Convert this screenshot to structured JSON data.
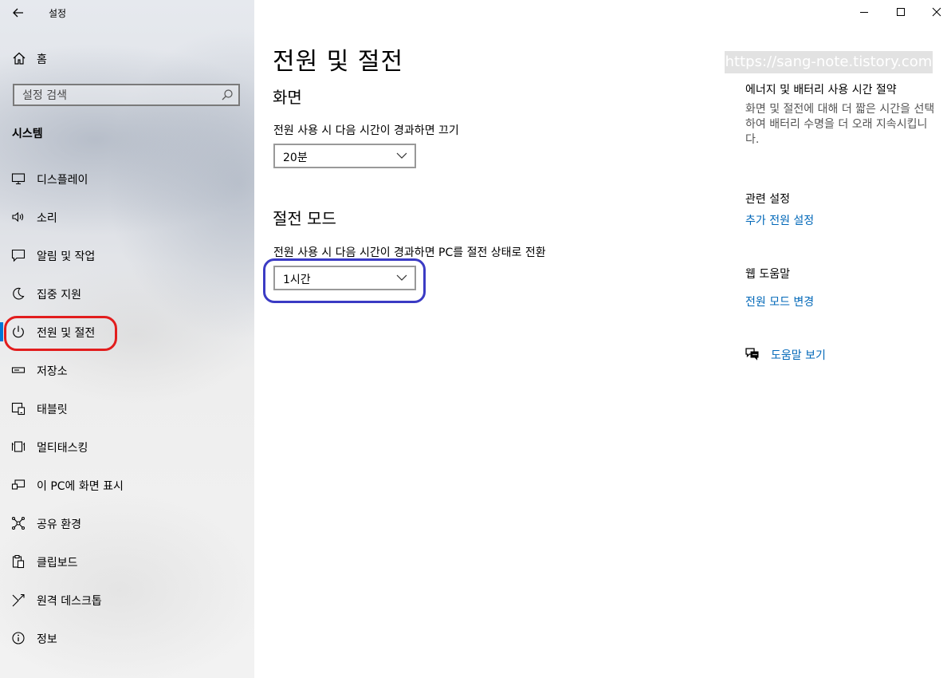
{
  "app": {
    "title": "설정"
  },
  "sidebar": {
    "home_label": "홈",
    "search_placeholder": "설정 검색",
    "section_title": "시스템",
    "items": [
      {
        "label": "디스플레이",
        "icon": "monitor-icon"
      },
      {
        "label": "소리",
        "icon": "speaker-icon"
      },
      {
        "label": "알림 및 작업",
        "icon": "message-icon"
      },
      {
        "label": "집중 지원",
        "icon": "moon-icon"
      },
      {
        "label": "전원 및 절전",
        "icon": "power-icon",
        "active": true
      },
      {
        "label": "저장소",
        "icon": "storage-icon"
      },
      {
        "label": "태블릿",
        "icon": "tablet-icon"
      },
      {
        "label": "멀티태스킹",
        "icon": "multitask-icon"
      },
      {
        "label": "이 PC에 화면 표시",
        "icon": "project-icon"
      },
      {
        "label": "공유 환경",
        "icon": "share-icon"
      },
      {
        "label": "클립보드",
        "icon": "clipboard-icon"
      },
      {
        "label": "원격 데스크톱",
        "icon": "remote-desktop-icon"
      },
      {
        "label": "정보",
        "icon": "info-icon"
      }
    ]
  },
  "main": {
    "title": "전원 및 절전",
    "screen": {
      "heading": "화면",
      "description": "전원 사용 시 다음 시간이 경과하면 끄기",
      "value": "20분"
    },
    "sleep": {
      "heading": "절전 모드",
      "description": "전원 사용 시 다음 시간이 경과하면 PC를 절전 상태로 전환",
      "value": "1시간"
    }
  },
  "right": {
    "watermark": "https://sang-note.tistory.com",
    "energy_heading": "에너지 및 배터리 사용 시간 절약",
    "energy_text": "화면 및 절전에 대해 더 짧은 시간을 선택하여 배터리 수명을 더 오래 지속시킵니다.",
    "related_heading": "관련 설정",
    "related_link": "추가 전원 설정",
    "web_help_heading": "웹 도움말",
    "web_help_link": "전원 모드 변경",
    "get_help_link": "도움말 보기"
  },
  "colors": {
    "accent": "#0078d7",
    "link": "#0067b8",
    "annotation_red": "#e21d1d",
    "annotation_blue": "#3b3bc4"
  }
}
